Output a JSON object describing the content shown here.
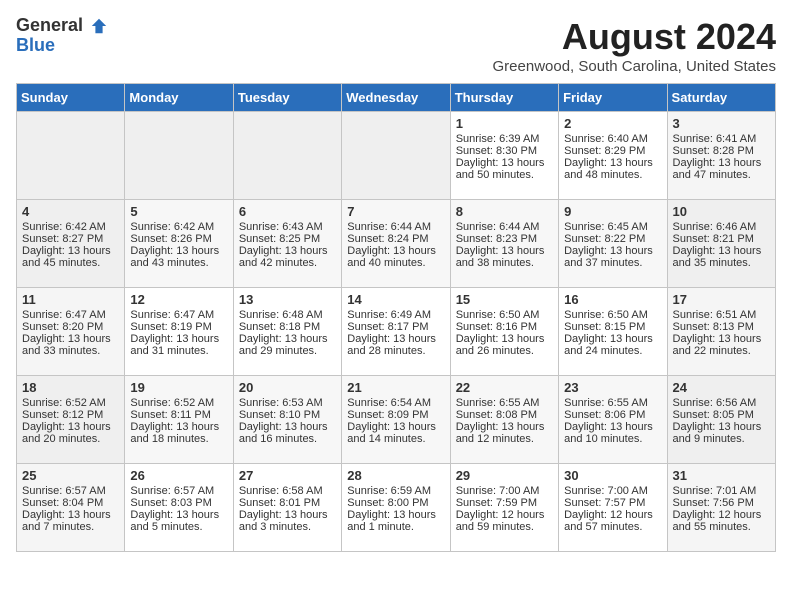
{
  "header": {
    "logo_general": "General",
    "logo_blue": "Blue",
    "title": "August 2024",
    "subtitle": "Greenwood, South Carolina, United States"
  },
  "calendar": {
    "days_of_week": [
      "Sunday",
      "Monday",
      "Tuesday",
      "Wednesday",
      "Thursday",
      "Friday",
      "Saturday"
    ],
    "weeks": [
      [
        {
          "day": "",
          "sunrise": "",
          "sunset": "",
          "daylight": "",
          "empty": true
        },
        {
          "day": "",
          "sunrise": "",
          "sunset": "",
          "daylight": "",
          "empty": true
        },
        {
          "day": "",
          "sunrise": "",
          "sunset": "",
          "daylight": "",
          "empty": true
        },
        {
          "day": "",
          "sunrise": "",
          "sunset": "",
          "daylight": "",
          "empty": true
        },
        {
          "day": "1",
          "sunrise": "Sunrise: 6:39 AM",
          "sunset": "Sunset: 8:30 PM",
          "daylight": "Daylight: 13 hours and 50 minutes.",
          "empty": false
        },
        {
          "day": "2",
          "sunrise": "Sunrise: 6:40 AM",
          "sunset": "Sunset: 8:29 PM",
          "daylight": "Daylight: 13 hours and 48 minutes.",
          "empty": false
        },
        {
          "day": "3",
          "sunrise": "Sunrise: 6:41 AM",
          "sunset": "Sunset: 8:28 PM",
          "daylight": "Daylight: 13 hours and 47 minutes.",
          "empty": false
        }
      ],
      [
        {
          "day": "4",
          "sunrise": "Sunrise: 6:42 AM",
          "sunset": "Sunset: 8:27 PM",
          "daylight": "Daylight: 13 hours and 45 minutes.",
          "empty": false
        },
        {
          "day": "5",
          "sunrise": "Sunrise: 6:42 AM",
          "sunset": "Sunset: 8:26 PM",
          "daylight": "Daylight: 13 hours and 43 minutes.",
          "empty": false
        },
        {
          "day": "6",
          "sunrise": "Sunrise: 6:43 AM",
          "sunset": "Sunset: 8:25 PM",
          "daylight": "Daylight: 13 hours and 42 minutes.",
          "empty": false
        },
        {
          "day": "7",
          "sunrise": "Sunrise: 6:44 AM",
          "sunset": "Sunset: 8:24 PM",
          "daylight": "Daylight: 13 hours and 40 minutes.",
          "empty": false
        },
        {
          "day": "8",
          "sunrise": "Sunrise: 6:44 AM",
          "sunset": "Sunset: 8:23 PM",
          "daylight": "Daylight: 13 hours and 38 minutes.",
          "empty": false
        },
        {
          "day": "9",
          "sunrise": "Sunrise: 6:45 AM",
          "sunset": "Sunset: 8:22 PM",
          "daylight": "Daylight: 13 hours and 37 minutes.",
          "empty": false
        },
        {
          "day": "10",
          "sunrise": "Sunrise: 6:46 AM",
          "sunset": "Sunset: 8:21 PM",
          "daylight": "Daylight: 13 hours and 35 minutes.",
          "empty": false
        }
      ],
      [
        {
          "day": "11",
          "sunrise": "Sunrise: 6:47 AM",
          "sunset": "Sunset: 8:20 PM",
          "daylight": "Daylight: 13 hours and 33 minutes.",
          "empty": false
        },
        {
          "day": "12",
          "sunrise": "Sunrise: 6:47 AM",
          "sunset": "Sunset: 8:19 PM",
          "daylight": "Daylight: 13 hours and 31 minutes.",
          "empty": false
        },
        {
          "day": "13",
          "sunrise": "Sunrise: 6:48 AM",
          "sunset": "Sunset: 8:18 PM",
          "daylight": "Daylight: 13 hours and 29 minutes.",
          "empty": false
        },
        {
          "day": "14",
          "sunrise": "Sunrise: 6:49 AM",
          "sunset": "Sunset: 8:17 PM",
          "daylight": "Daylight: 13 hours and 28 minutes.",
          "empty": false
        },
        {
          "day": "15",
          "sunrise": "Sunrise: 6:50 AM",
          "sunset": "Sunset: 8:16 PM",
          "daylight": "Daylight: 13 hours and 26 minutes.",
          "empty": false
        },
        {
          "day": "16",
          "sunrise": "Sunrise: 6:50 AM",
          "sunset": "Sunset: 8:15 PM",
          "daylight": "Daylight: 13 hours and 24 minutes.",
          "empty": false
        },
        {
          "day": "17",
          "sunrise": "Sunrise: 6:51 AM",
          "sunset": "Sunset: 8:13 PM",
          "daylight": "Daylight: 13 hours and 22 minutes.",
          "empty": false
        }
      ],
      [
        {
          "day": "18",
          "sunrise": "Sunrise: 6:52 AM",
          "sunset": "Sunset: 8:12 PM",
          "daylight": "Daylight: 13 hours and 20 minutes.",
          "empty": false
        },
        {
          "day": "19",
          "sunrise": "Sunrise: 6:52 AM",
          "sunset": "Sunset: 8:11 PM",
          "daylight": "Daylight: 13 hours and 18 minutes.",
          "empty": false
        },
        {
          "day": "20",
          "sunrise": "Sunrise: 6:53 AM",
          "sunset": "Sunset: 8:10 PM",
          "daylight": "Daylight: 13 hours and 16 minutes.",
          "empty": false
        },
        {
          "day": "21",
          "sunrise": "Sunrise: 6:54 AM",
          "sunset": "Sunset: 8:09 PM",
          "daylight": "Daylight: 13 hours and 14 minutes.",
          "empty": false
        },
        {
          "day": "22",
          "sunrise": "Sunrise: 6:55 AM",
          "sunset": "Sunset: 8:08 PM",
          "daylight": "Daylight: 13 hours and 12 minutes.",
          "empty": false
        },
        {
          "day": "23",
          "sunrise": "Sunrise: 6:55 AM",
          "sunset": "Sunset: 8:06 PM",
          "daylight": "Daylight: 13 hours and 10 minutes.",
          "empty": false
        },
        {
          "day": "24",
          "sunrise": "Sunrise: 6:56 AM",
          "sunset": "Sunset: 8:05 PM",
          "daylight": "Daylight: 13 hours and 9 minutes.",
          "empty": false
        }
      ],
      [
        {
          "day": "25",
          "sunrise": "Sunrise: 6:57 AM",
          "sunset": "Sunset: 8:04 PM",
          "daylight": "Daylight: 13 hours and 7 minutes.",
          "empty": false
        },
        {
          "day": "26",
          "sunrise": "Sunrise: 6:57 AM",
          "sunset": "Sunset: 8:03 PM",
          "daylight": "Daylight: 13 hours and 5 minutes.",
          "empty": false
        },
        {
          "day": "27",
          "sunrise": "Sunrise: 6:58 AM",
          "sunset": "Sunset: 8:01 PM",
          "daylight": "Daylight: 13 hours and 3 minutes.",
          "empty": false
        },
        {
          "day": "28",
          "sunrise": "Sunrise: 6:59 AM",
          "sunset": "Sunset: 8:00 PM",
          "daylight": "Daylight: 13 hours and 1 minute.",
          "empty": false
        },
        {
          "day": "29",
          "sunrise": "Sunrise: 7:00 AM",
          "sunset": "Sunset: 7:59 PM",
          "daylight": "Daylight: 12 hours and 59 minutes.",
          "empty": false
        },
        {
          "day": "30",
          "sunrise": "Sunrise: 7:00 AM",
          "sunset": "Sunset: 7:57 PM",
          "daylight": "Daylight: 12 hours and 57 minutes.",
          "empty": false
        },
        {
          "day": "31",
          "sunrise": "Sunrise: 7:01 AM",
          "sunset": "Sunset: 7:56 PM",
          "daylight": "Daylight: 12 hours and 55 minutes.",
          "empty": false
        }
      ]
    ]
  }
}
